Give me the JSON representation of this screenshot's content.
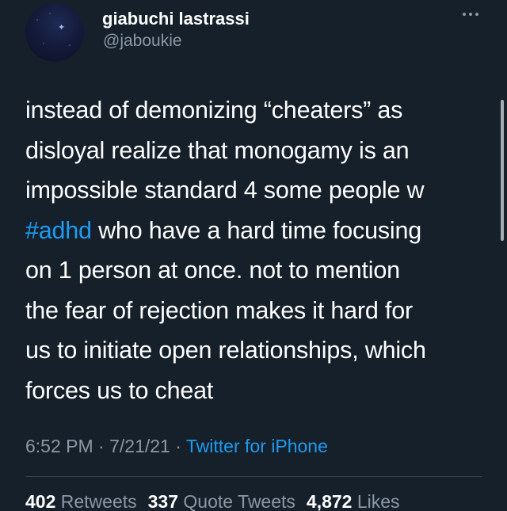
{
  "author": {
    "display_name": "giabuchi lastrassi",
    "handle": "@jaboukie",
    "avatar_icon": "starry-night-avatar-icon"
  },
  "more_icon": "more-horizontal-icon",
  "tweet": {
    "lines": [
      {
        "text": "instead of demonizing “cheaters” as"
      },
      {
        "text": "disloyal realize that monogamy is an"
      },
      {
        "text": "impossible standard 4 some people w"
      },
      {
        "hashtag": "#adhd",
        "text": " who have a hard time focusing"
      },
      {
        "text": "on 1 person at once. not to mention"
      },
      {
        "text": "the fear of rejection makes it hard for"
      },
      {
        "text": "us to initiate open relationships, which"
      },
      {
        "text": "forces us to cheat"
      }
    ]
  },
  "meta": {
    "time": "6:52 PM",
    "separator": " · ",
    "date": "7/21/21",
    "source": "Twitter for iPhone"
  },
  "stats": {
    "retweets_count": "402",
    "retweets_label": "Retweets",
    "quotes_count": "337",
    "quotes_label": "Quote Tweets",
    "likes_count": "4,872",
    "likes_label": "Likes"
  },
  "colors": {
    "background": "#15202b",
    "link": "#1d9bf0",
    "secondary_text": "#8b98a5",
    "divider": "#38444d"
  }
}
